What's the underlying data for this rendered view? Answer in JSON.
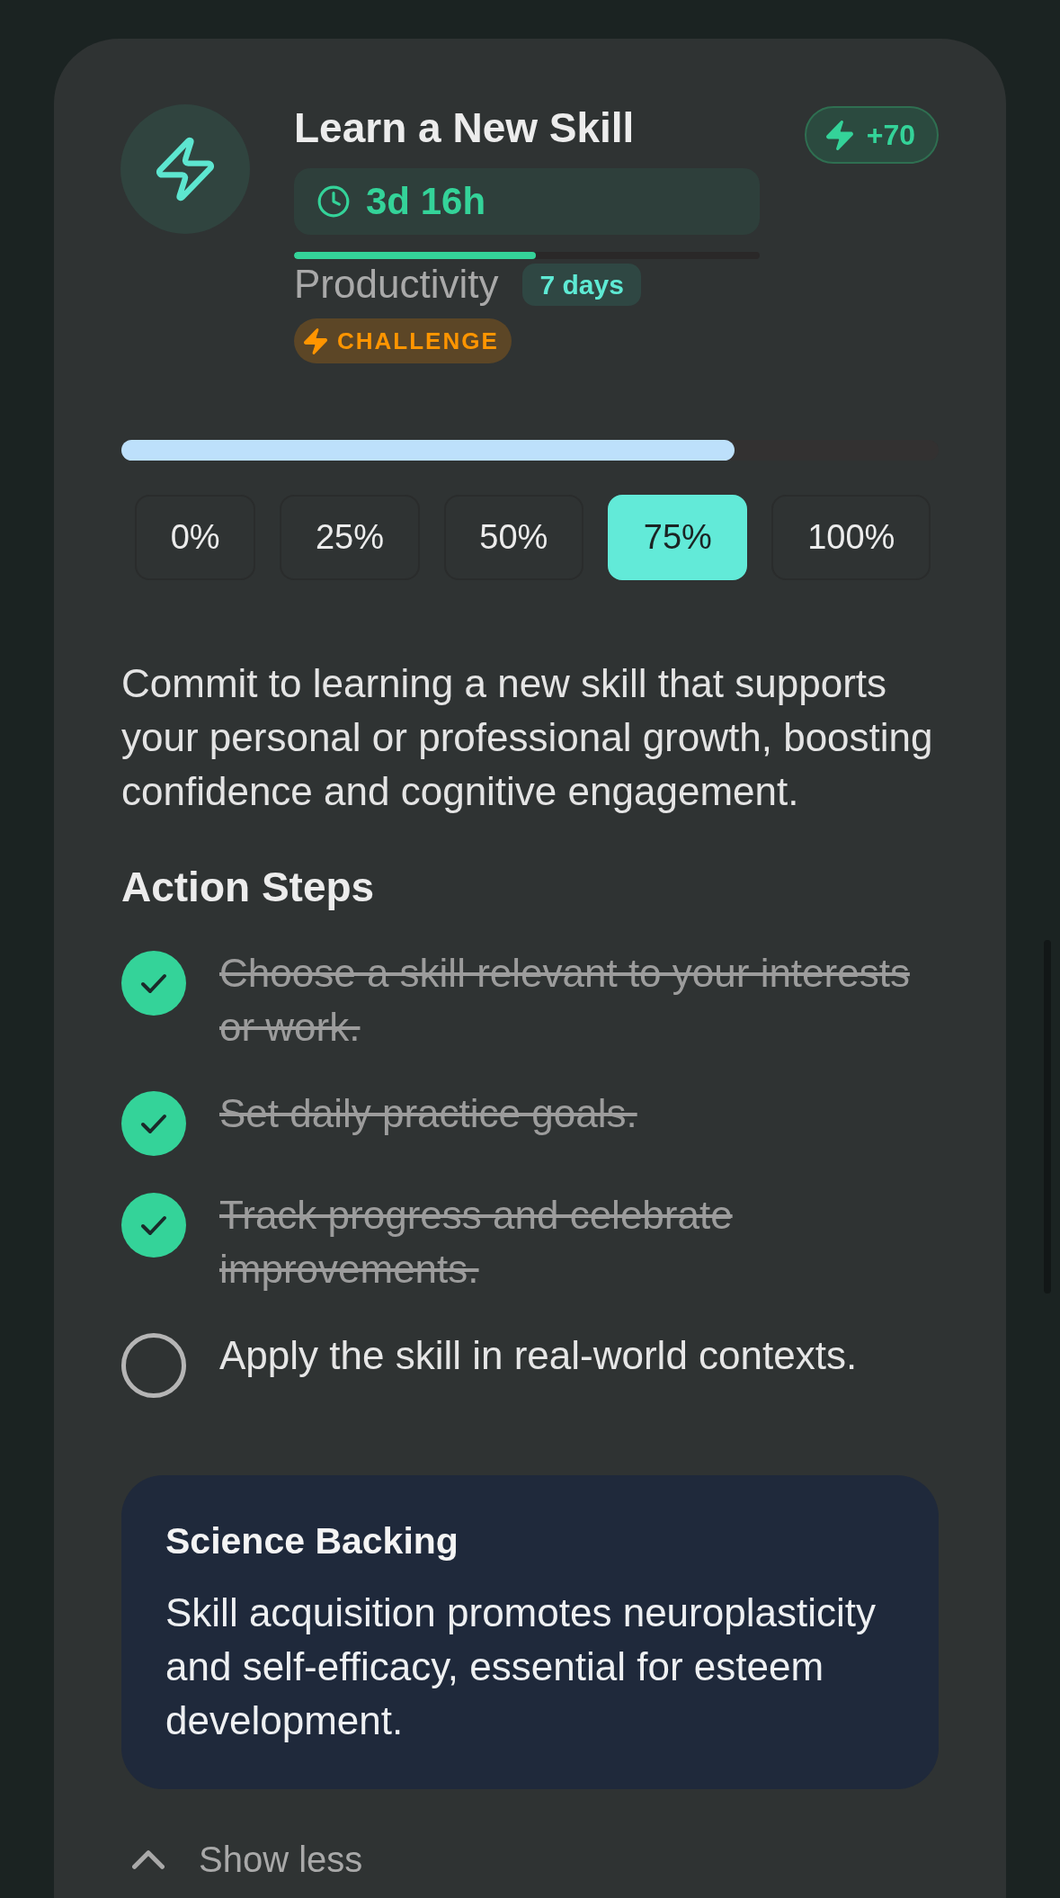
{
  "header": {
    "title": "Learn a New Skill",
    "reward": "+70",
    "timer": {
      "label": "3d 16h",
      "level": 0.52
    },
    "category": "Productivity",
    "duration": "7 days",
    "badge": {
      "kind": "challenge",
      "label": "CHALLENGE"
    }
  },
  "progress": {
    "level": 0.75,
    "options": [
      {
        "label": "0%",
        "selected": false
      },
      {
        "label": "25%",
        "selected": false
      },
      {
        "label": "50%",
        "selected": false
      },
      {
        "label": "75%",
        "selected": true
      },
      {
        "label": "100%",
        "selected": false
      }
    ]
  },
  "description": "Commit to learning a new skill that supports your personal or professional growth, boosting confidence and cognitive engagement.",
  "action_steps": {
    "title": "Action Steps",
    "items": [
      {
        "text": "Choose a skill relevant to your interests or work.",
        "checked": true
      },
      {
        "text": "Set daily practice goals.",
        "checked": true
      },
      {
        "text": "Track progress and celebrate improvements.",
        "checked": true
      },
      {
        "text": "Apply the skill in real-world contexts.",
        "checked": false
      }
    ]
  },
  "science": {
    "title": "Science Backing",
    "text": "Skill acquisition promotes neuroplasticity and self-efficacy, essential for esteem development."
  },
  "toggle": {
    "label": "Show less",
    "expanded": true
  }
}
